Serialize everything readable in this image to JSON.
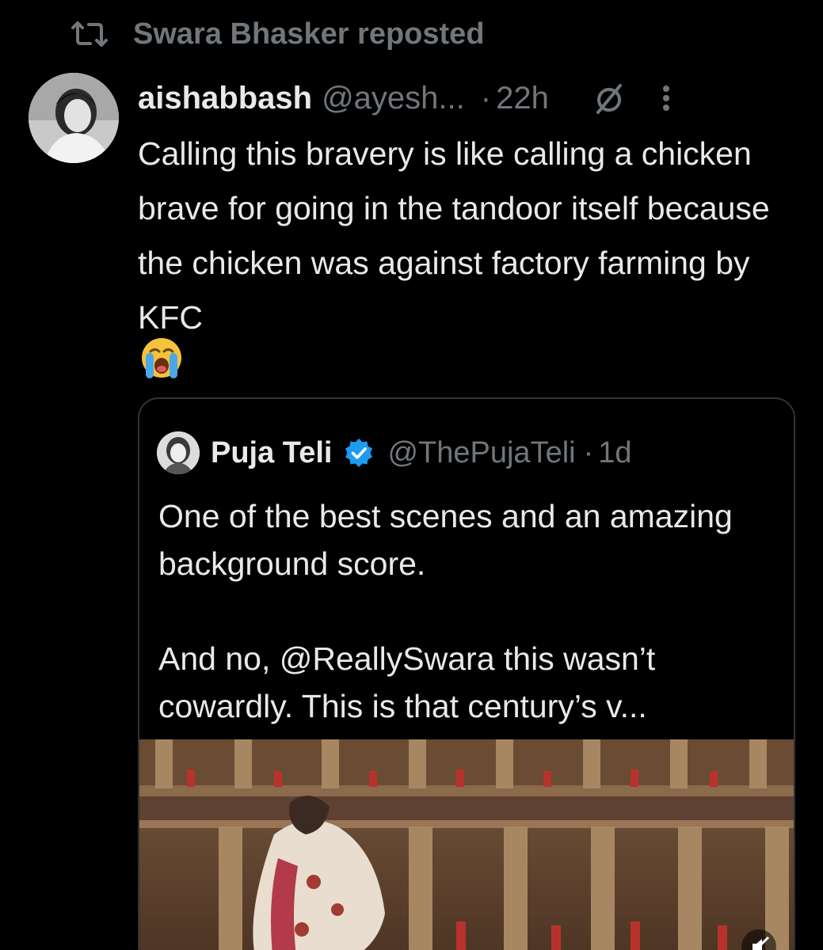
{
  "repost": {
    "label": "Swara Bhasker reposted",
    "icon": "repost-icon"
  },
  "post": {
    "author_name": "aishabbash",
    "author_handle": "@ayesh...",
    "time": "22h",
    "separator": "·",
    "text": "Calling this bravery is like calling a chicken brave for going in the tandoor itself because the chicken was against factory farming by KFC",
    "emoji": "😭",
    "icons": [
      "mute-icon",
      "more-icon"
    ]
  },
  "quote": {
    "author_name": "Puja Teli",
    "author_handle": "@ThePujaTeli",
    "time": "1d",
    "separator": "·",
    "verified": true,
    "paragraph1": "One of the best scenes and an amazing background score.",
    "paragraph2": "And no, @ReallySwara this wasn’t cowardly. This is that century’s v...",
    "media": "video-thumbnail"
  },
  "colors": {
    "background": "#000000",
    "text": "#e7e9ea",
    "secondary": "#71767b",
    "border": "#2f3336",
    "verified": "#1d9bf0"
  }
}
